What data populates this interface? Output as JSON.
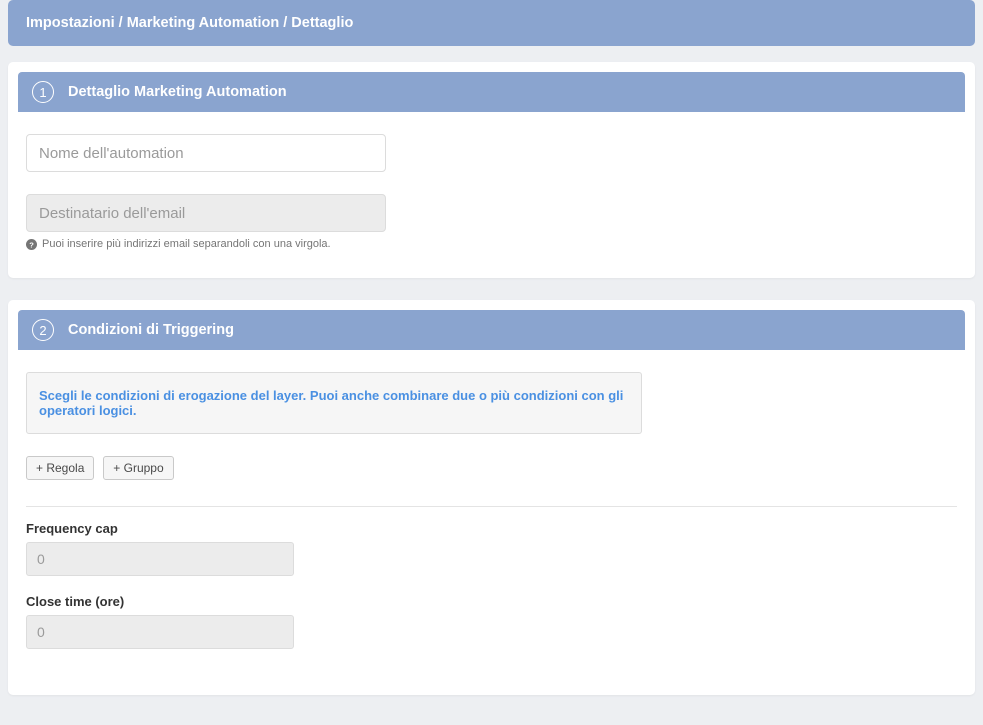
{
  "breadcrumb": "Impostazioni / Marketing Automation / Dettaglio",
  "section1": {
    "step": "1",
    "title": "Dettaglio Marketing Automation",
    "name_placeholder": "Nome dell'automation",
    "recipient_placeholder": "Destinatario dell'email",
    "helper": "Puoi inserire più indirizzi email separandoli con una virgola."
  },
  "section2": {
    "step": "2",
    "title": "Condizioni di Triggering",
    "info": "Scegli le condizioni di erogazione del layer. Puoi anche combinare due o più condizioni con gli operatori logici.",
    "add_rule": "+ Regola",
    "add_group": "+ Gruppo",
    "freq_label": "Frequency cap",
    "freq_value": "0",
    "close_label": "Close time (ore)",
    "close_value": "0"
  }
}
